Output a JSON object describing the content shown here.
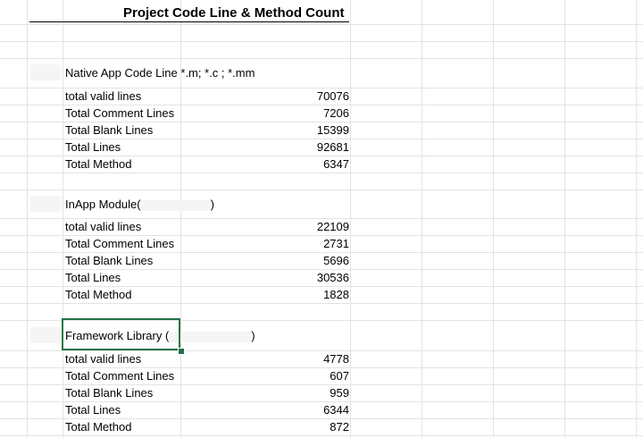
{
  "sheet": {
    "title": "Project Code Line & Method Count",
    "sections": [
      {
        "header_label": "Native App Code Line",
        "header_suffix": "*.m; *.c ; *.mm",
        "rows": [
          {
            "label": "total valid lines",
            "value": "70076"
          },
          {
            "label": "Total Comment Lines",
            "value": "7206"
          },
          {
            "label": "Total Blank Lines",
            "value": "15399"
          },
          {
            "label": "Total Lines",
            "value": "92681"
          },
          {
            "label": "Total Method",
            "value": "6347"
          }
        ]
      },
      {
        "header_label": "InApp Module(",
        "header_suffix": ")",
        "rows": [
          {
            "label": "total valid lines",
            "value": "22109"
          },
          {
            "label": "Total Comment Lines",
            "value": "2731"
          },
          {
            "label": "Total Blank Lines",
            "value": "5696"
          },
          {
            "label": "Total Lines",
            "value": "30536"
          },
          {
            "label": "Total Method",
            "value": "1828"
          }
        ]
      },
      {
        "header_label": "Framework Library (",
        "header_suffix": ")",
        "rows": [
          {
            "label": "total valid lines",
            "value": "4778"
          },
          {
            "label": "Total Comment Lines",
            "value": "607"
          },
          {
            "label": "Total Blank Lines",
            "value": "959"
          },
          {
            "label": "Total Lines",
            "value": "6344"
          },
          {
            "label": "Total Method",
            "value": "872"
          }
        ]
      }
    ]
  },
  "selection": {
    "accent_color": "#217346",
    "selected_cell": "Framework Library ("
  }
}
